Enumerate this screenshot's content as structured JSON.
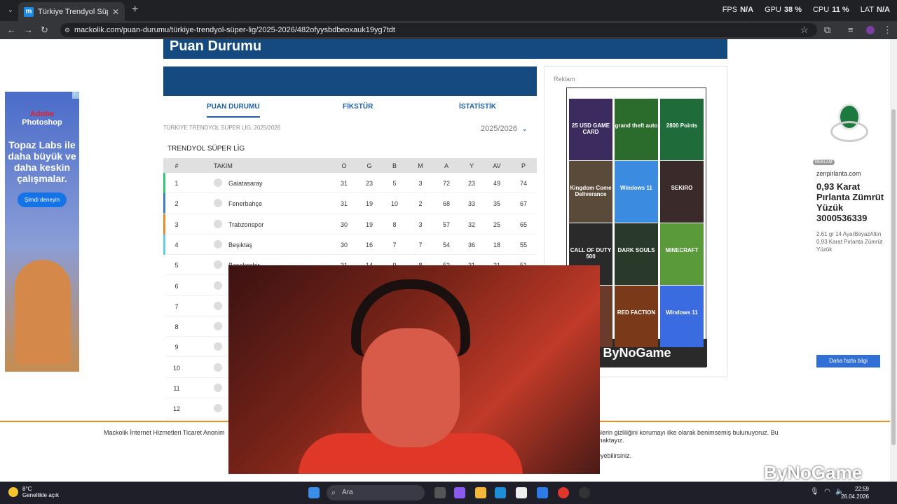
{
  "browser": {
    "tab_title": "Türkiye Trendyol Süper Lig 2025",
    "tab_favicon": "m",
    "url": "mackolik.com/puan-durumu/türkiye-trendyol-süper-lig/2025-2026/482ofyysbdbeoxauk19yg7tdt",
    "stats": [
      {
        "label": "FPS",
        "value": "N/A"
      },
      {
        "label": "GPU",
        "value": "38 %"
      },
      {
        "label": "CPU",
        "value": "11 %"
      },
      {
        "label": "LAT",
        "value": "N/A"
      }
    ]
  },
  "page": {
    "header": "Puan Durumu",
    "tabs": [
      "PUAN DURUMU",
      "FİKSTÜR",
      "İSTATİSTİK"
    ],
    "breadcrumb": "TÜRKİYE TRENDYOL SÜPER LİG, 2025/2026",
    "season": "2025/2026",
    "league": "TRENDYOL SÜPER LİG",
    "columns": [
      "#",
      "TAKIM",
      "O",
      "G",
      "B",
      "M",
      "A",
      "Y",
      "AV",
      "P"
    ],
    "rows": [
      {
        "pos": "1",
        "team": "Galatasaray",
        "o": "31",
        "g": "23",
        "b": "5",
        "m": "3",
        "a": "72",
        "y": "23",
        "av": "49",
        "p": "74",
        "color": "#2ecc71"
      },
      {
        "pos": "2",
        "team": "Fenerbahçe",
        "o": "31",
        "g": "19",
        "b": "10",
        "m": "2",
        "a": "68",
        "y": "33",
        "av": "35",
        "p": "67",
        "color": "#3a7bd5"
      },
      {
        "pos": "3",
        "team": "Trabzonspor",
        "o": "30",
        "g": "19",
        "b": "8",
        "m": "3",
        "a": "57",
        "y": "32",
        "av": "25",
        "p": "65",
        "color": "#f08a24"
      },
      {
        "pos": "4",
        "team": "Beşiktaş",
        "o": "30",
        "g": "16",
        "b": "7",
        "m": "7",
        "a": "54",
        "y": "36",
        "av": "18",
        "p": "55",
        "color": "#5ed1e8"
      },
      {
        "pos": "5",
        "team": "Başakşehir",
        "o": "31",
        "g": "14",
        "b": "9",
        "m": "8",
        "a": "52",
        "y": "31",
        "av": "21",
        "p": "51",
        "color": "#ffffff"
      },
      {
        "pos": "6",
        "team": "",
        "o": "",
        "g": "",
        "b": "",
        "m": "",
        "a": "",
        "y": "",
        "av": "",
        "p": "",
        "color": "#ffffff"
      },
      {
        "pos": "7",
        "team": "",
        "o": "",
        "g": "",
        "b": "",
        "m": "",
        "a": "",
        "y": "",
        "av": "",
        "p": "",
        "color": "#ffffff"
      },
      {
        "pos": "8",
        "team": "",
        "o": "",
        "g": "",
        "b": "",
        "m": "",
        "a": "",
        "y": "",
        "av": "",
        "p": "",
        "color": "#ffffff"
      },
      {
        "pos": "9",
        "team": "",
        "o": "",
        "g": "",
        "b": "",
        "m": "",
        "a": "",
        "y": "",
        "av": "",
        "p": "",
        "color": "#ffffff"
      },
      {
        "pos": "10",
        "team": "",
        "o": "",
        "g": "",
        "b": "",
        "m": "",
        "a": "",
        "y": "",
        "av": "",
        "p": "",
        "color": "#ffffff"
      },
      {
        "pos": "11",
        "team": "",
        "o": "",
        "g": "",
        "b": "",
        "m": "",
        "a": "",
        "y": "",
        "av": "",
        "p": "",
        "color": "#ffffff"
      },
      {
        "pos": "12",
        "team": "",
        "o": "",
        "g": "",
        "b": "",
        "m": "",
        "a": "",
        "y": "",
        "av": "",
        "p": "",
        "color": "#ffffff"
      }
    ]
  },
  "ads": {
    "reklam_label": "Reklam",
    "grid_tiles": [
      {
        "label": "25 USD GAME CARD",
        "color": "#3b2b5e"
      },
      {
        "label": "grand theft auto",
        "color": "#2b6b2b"
      },
      {
        "label": "2800 Points",
        "color": "#1f6b3a"
      },
      {
        "label": "Kingdom Come Deliverance",
        "color": "#5a4a3a"
      },
      {
        "label": "Windows 11",
        "color": "#3b8be0"
      },
      {
        "label": "SEKIRO",
        "color": "#3a2a2a"
      },
      {
        "label": "CALL OF DUTY 500",
        "color": "#2a2a2a"
      },
      {
        "label": "DARK SOULS",
        "color": "#2a3a2a"
      },
      {
        "label": "MINECRAFT",
        "color": "#5a9a3a"
      },
      {
        "label": "",
        "color": "#6a3a2a"
      },
      {
        "label": "RED FACTION",
        "color": "#7a3a1a"
      },
      {
        "label": "Windows 11",
        "color": "#3b6be0"
      }
    ],
    "bynogame": "ByNoGame",
    "left": {
      "brand_adobe": "Adobe",
      "brand_ps": "Photoshop",
      "pitch": "Topaz Labs ile daha büyük ve daha keskin çalışmalar.",
      "cta": "Şimdi deneyin"
    },
    "right": {
      "reklam": "REKLAM",
      "site": "zenpirlanta.com",
      "title": "0,93 Karat Pırlanta Zümrüt Yüzük 3000536339",
      "desc": "2.61 gr 14 AyarBeyazAltın 0,93 Karat Pırlanta Zümrüt Yüzük",
      "button": "Daha fazla bilgi"
    }
  },
  "cookie": {
    "line1": "Mackolik İnternet Hizmetleri Ticaret Anonim",
    "line2": "nlerin gizliliğini korumayı ilke olarak benimsemiş bulunuyoruz. Bu maktayız.",
    "line3": "eyebilirsiniz."
  },
  "watermark": "ByNoGame",
  "taskbar": {
    "temp": "8°C",
    "weather": "Genellikle açık",
    "search_placeholder": "Ara",
    "time": "22:59",
    "date": "26.04.2026"
  }
}
